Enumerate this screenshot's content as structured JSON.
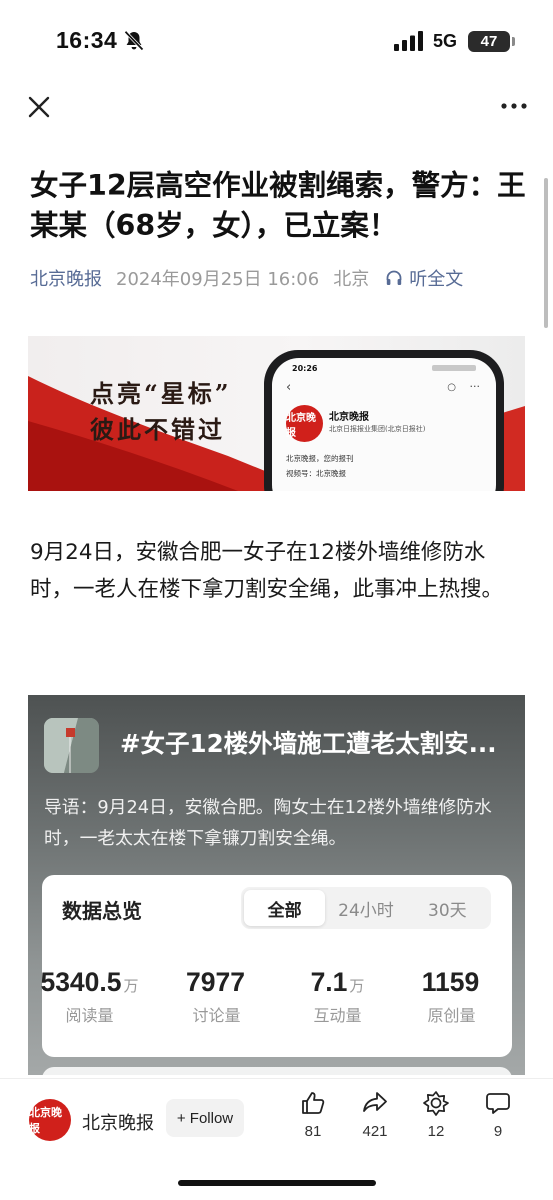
{
  "status_bar": {
    "time": "16:34",
    "network": "5G",
    "battery": "47"
  },
  "nav": {
    "close_icon": "close-icon",
    "more_icon": "more-dots-icon"
  },
  "article": {
    "title": "女子12层高空作业被割绳索，警方：王某某（68岁，女），已立案！",
    "source": "北京晚报",
    "datetime": "2024年09月25日 16:06",
    "location": "北京",
    "listen_label": "听全文",
    "body": "9月24日，安徽合肥一女子在12楼外墙维修防水时，一老人在楼下拿刀割安全绳，此事冲上热搜。"
  },
  "banner": {
    "slogan_line1": "点亮“星标”",
    "slogan_line2": "彼此不错过",
    "phone_time": "20:26",
    "phone_account_name": "北京晚报",
    "phone_account_org": "北京日报报业集团(北京日报社)",
    "phone_line1": "北京晚报，您的报刊",
    "phone_line2": "视频号：北京晚报",
    "logo_text": "北京晚报"
  },
  "topic": {
    "title": "#女子12楼外墙施工遭老太割安...",
    "intro": "导语：9月24日，安徽合肥。陶女士在12楼外墙维修防水时，一老太太在楼下拿镰刀割安全绳。",
    "stats_title": "数据总览",
    "tabs": [
      "全部",
      "24小时",
      "30天"
    ],
    "stats": [
      {
        "value": "5340.5",
        "unit": "万",
        "label": "阅读量"
      },
      {
        "value": "7977",
        "unit": "",
        "label": "讨论量"
      },
      {
        "value": "7.1",
        "unit": "万",
        "label": "互动量"
      },
      {
        "value": "1159",
        "unit": "",
        "label": "原创量"
      }
    ]
  },
  "bottom_bar": {
    "account_name": "北京晚报",
    "avatar_text": "北京晚报",
    "follow_label": "+ Follow",
    "actions": [
      {
        "icon": "thumbs-up-icon",
        "count": "81"
      },
      {
        "icon": "share-icon",
        "count": "421"
      },
      {
        "icon": "wow-icon",
        "count": "12"
      },
      {
        "icon": "comment-icon",
        "count": "9"
      }
    ]
  }
}
